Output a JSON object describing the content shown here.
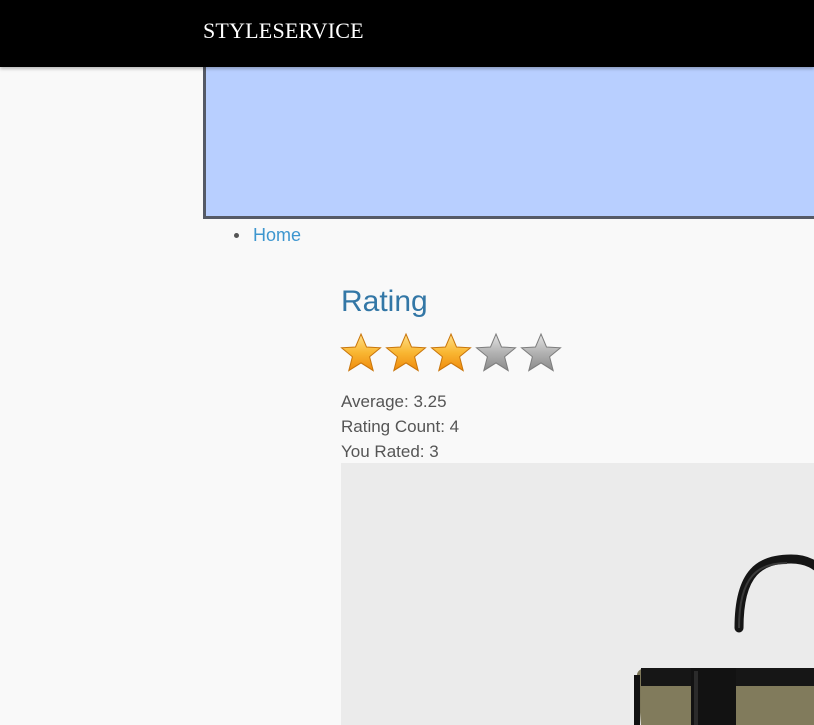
{
  "header": {
    "brand": "STYLESERVICE"
  },
  "banner": {
    "color": "#b8cfff"
  },
  "nav": {
    "items": [
      {
        "label": "Home"
      }
    ]
  },
  "rating": {
    "title": "Rating",
    "stars_total": 5,
    "stars_filled": 3,
    "average": "Average: 3.25",
    "count": "Rating Count: 4",
    "you_rated": "You Rated: 3"
  },
  "colors": {
    "topbar": "#000000",
    "link": "#3d96cf",
    "heading": "#3377a6",
    "star_on": "#f7a51c",
    "star_off": "#9a9a9a"
  },
  "product": {
    "image_subject": "handbag-image"
  }
}
